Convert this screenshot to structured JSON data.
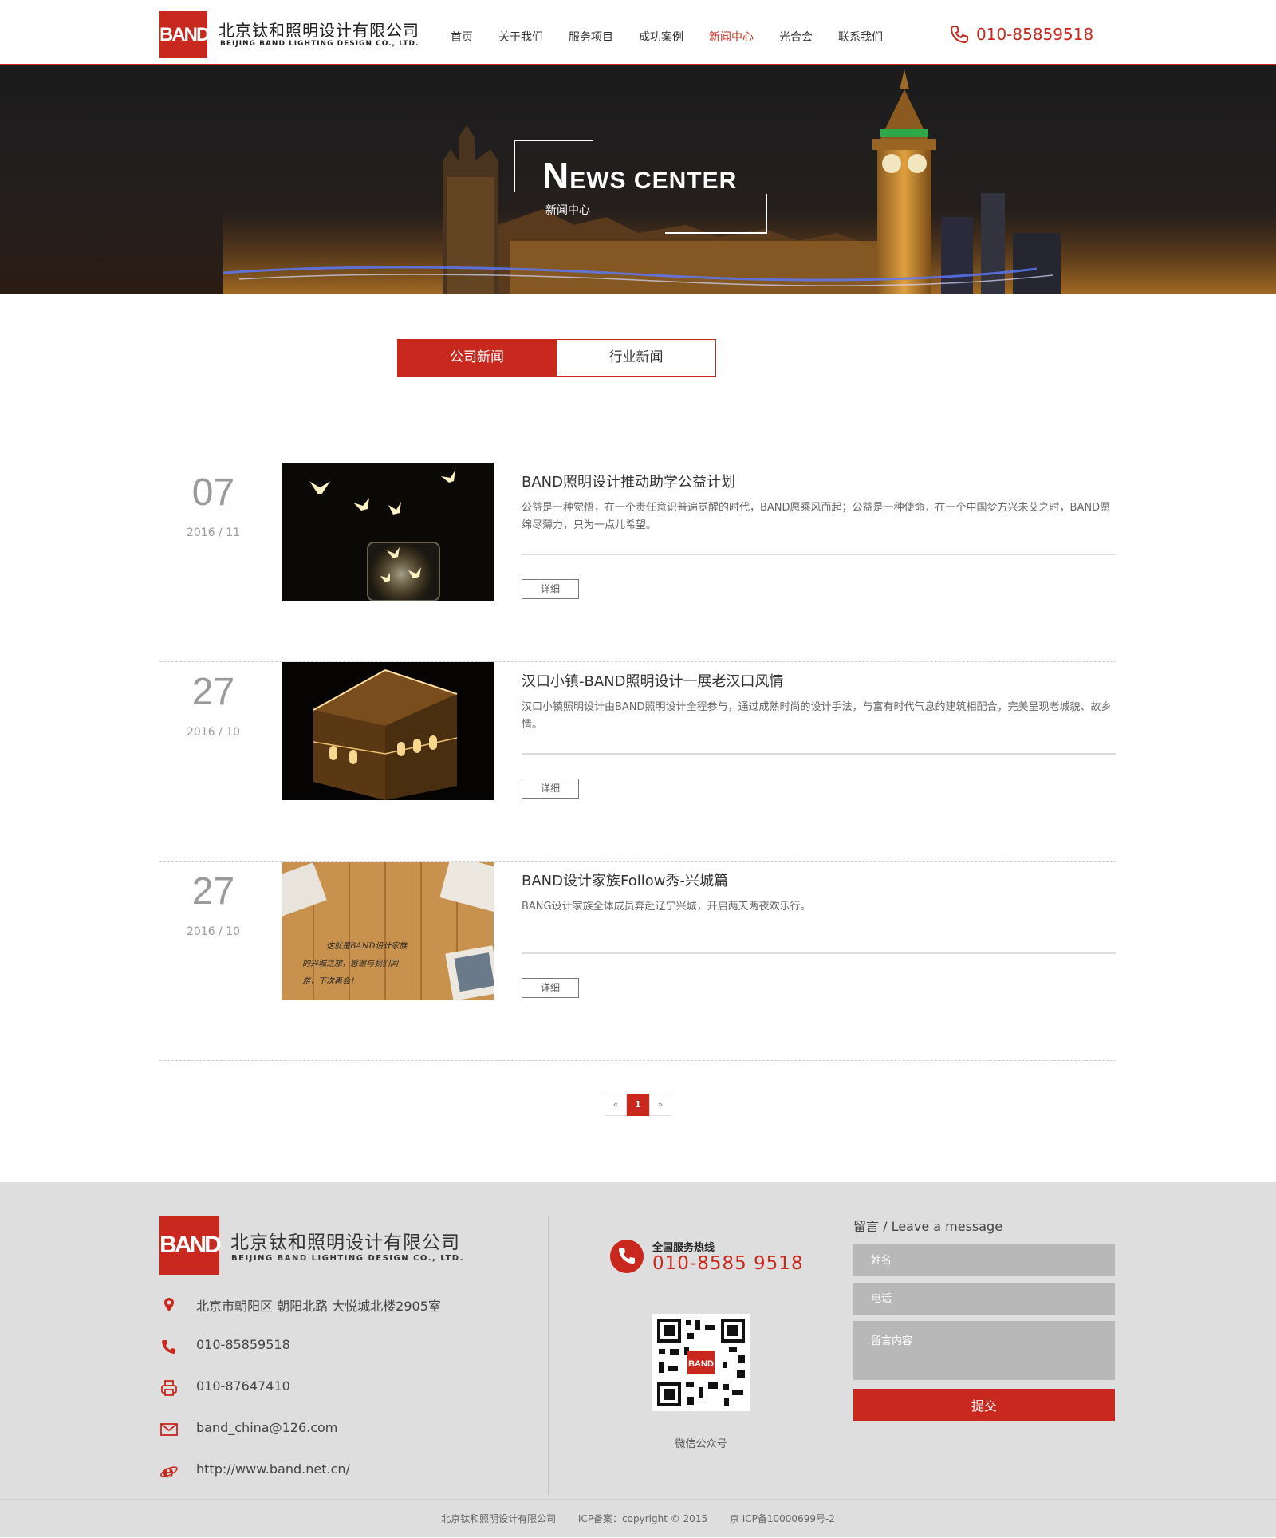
{
  "header": {
    "logo_text": "BAND",
    "company_cn": "北京钛和照明设计有限公司",
    "company_en": "BEIJING BAND LIGHTING DESIGN CO., LTD.",
    "nav": [
      {
        "label": "首页",
        "active": false
      },
      {
        "label": "关于我们",
        "active": false
      },
      {
        "label": "服务项目",
        "active": false
      },
      {
        "label": "成功案例",
        "active": false
      },
      {
        "label": "新闻中心",
        "active": true
      },
      {
        "label": "光合会",
        "active": false
      },
      {
        "label": "联系我们",
        "active": false
      }
    ],
    "phone": "010-85859518"
  },
  "banner": {
    "title_first": "N",
    "title_rest": "EWS CENTER",
    "subtitle": "新闻中心"
  },
  "tabs": [
    {
      "label": "公司新闻",
      "active": true
    },
    {
      "label": "行业新闻",
      "active": false
    }
  ],
  "news": [
    {
      "day": "07",
      "year_month": "2016 / 11",
      "title": "BAND照明设计推动助学公益计划",
      "desc": "公益是一种觉悟，在一个责任意识普遍觉醒的时代，BAND愿乘风而起；公益是一种使命，在一个中国梦方兴未艾之时，BAND愿绵尽薄力，只为一点儿希望。",
      "button": "详细",
      "image": "butterflies-jar"
    },
    {
      "day": "27",
      "year_month": "2016 / 10",
      "title": "汉口小镇-BAND照明设计一展老汉口风情",
      "desc": "汉口小镇照明设计由BAND照明设计全程参与，通过成熟时尚的设计手法，与富有时代气息的建筑相配合，完美呈现老城貌、故乡情。",
      "button": "详细",
      "image": "lit-building"
    },
    {
      "day": "27",
      "year_month": "2016 / 10",
      "title": "BAND设计家族Follow秀-兴城篇",
      "desc": "BANG设计家族全体成员奔赴辽宁兴城，开启两天两夜欢乐行。",
      "button": "详细",
      "image": "wood-photos",
      "image_text": [
        "这就是BAND设计家族",
        "的兴城之旅，感谢与我们同",
        "游，下次再会！"
      ]
    }
  ],
  "pagination": {
    "prev": "«",
    "current": "1",
    "next": "»"
  },
  "footer": {
    "logo_text": "BAND",
    "company_cn": "北京钛和照明设计有限公司",
    "company_en": "BEIJING BAND LIGHTING DESIGN CO., LTD.",
    "contacts": [
      {
        "icon": "location-icon",
        "text": "北京市朝阳区 朝阳北路 大悦城北楼2905室"
      },
      {
        "icon": "phone-icon",
        "text": "010-85859518"
      },
      {
        "icon": "fax-icon",
        "text": "010-87647410"
      },
      {
        "icon": "mail-icon",
        "text": "band_china@126.com"
      },
      {
        "icon": "ie-icon",
        "text": "http://www.band.net.cn/"
      }
    ],
    "hotline_label": "全国服务热线",
    "hotline_number": "010-8585 9518",
    "qr_label": "微信公众号",
    "qr_logo": "BAND",
    "message_title": "留言 / Leave a message",
    "name_placeholder": "姓名",
    "phone_placeholder": "电话",
    "content_placeholder": "留言内容",
    "submit_label": "提交",
    "copyright": [
      "北京钛和照明设计有限公司",
      "ICP备案：copyright © 2015",
      "京 ICP备10000699号-2"
    ]
  },
  "colors": {
    "accent": "#c8281e",
    "footer_bg": "#dedede",
    "input_bg": "#b8b8b8"
  }
}
